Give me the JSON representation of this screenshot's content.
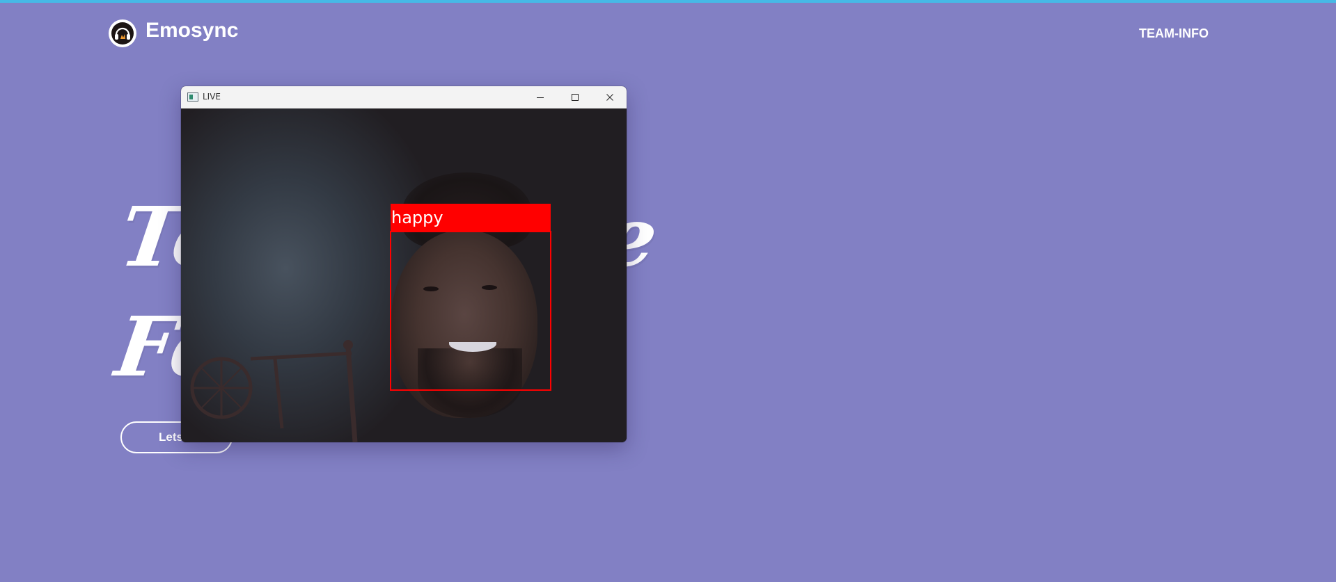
{
  "header": {
    "brand_name": "Emosync",
    "nav_team_info": "TEAM-INFO"
  },
  "hero": {
    "line1": "To",
    "line1_tail": "e",
    "line2": "Fe",
    "cta_label": "Lets S"
  },
  "live_window": {
    "title": "LIVE",
    "detection_label": "happy"
  },
  "colors": {
    "background": "#8280c4",
    "top_strip": "#46b9e6",
    "detection": "#ff0000"
  },
  "icons": {
    "logo": "headphones-logo-icon",
    "app": "window-app-icon",
    "minimize": "minimize-icon",
    "maximize": "maximize-icon",
    "close": "close-icon"
  }
}
